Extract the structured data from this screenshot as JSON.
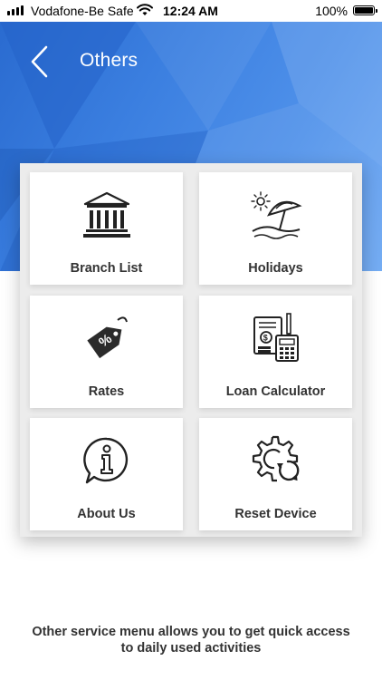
{
  "status_bar": {
    "carrier": "Vodafone-Be Safe",
    "time": "12:24 AM",
    "battery": "100%"
  },
  "header": {
    "title": "Others",
    "back_icon": "chevron-left-icon",
    "background_color": "#3b7fe0"
  },
  "tiles": [
    {
      "label": "Branch List",
      "icon": "bank-building-icon"
    },
    {
      "label": "Holidays",
      "icon": "beach-umbrella-icon"
    },
    {
      "label": "Rates",
      "icon": "percent-tag-icon"
    },
    {
      "label": "Loan Calculator",
      "icon": "calculator-document-icon"
    },
    {
      "label": "About Us",
      "icon": "info-bubble-icon"
    },
    {
      "label": "Reset Device",
      "icon": "gear-refresh-icon"
    }
  ],
  "footer": {
    "text": "Other service menu allows you to get quick access to daily used activities"
  }
}
